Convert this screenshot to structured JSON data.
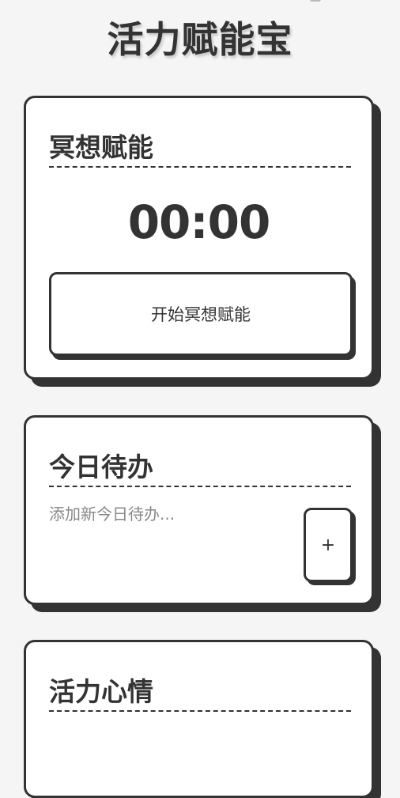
{
  "app": {
    "title": "活力赋能宝"
  },
  "meditation": {
    "title": "冥想赋能",
    "timer": "00:00",
    "start_label": "开始冥想赋能"
  },
  "todo": {
    "title": "今日待办",
    "input_placeholder": "添加新今日待办...",
    "input_value": "",
    "add_label": "+"
  },
  "mood": {
    "title": "活力心情"
  },
  "colors": {
    "background": "#f5f5f5",
    "card": "#ffffff",
    "ink": "#333333",
    "placeholder": "#888888"
  }
}
